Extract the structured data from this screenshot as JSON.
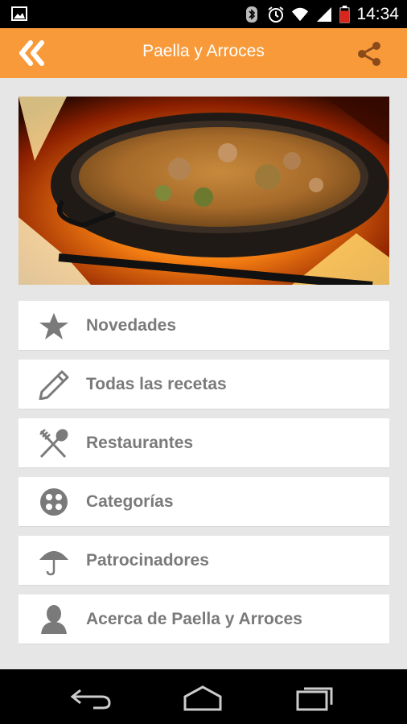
{
  "status_bar": {
    "time": "14:34",
    "icons": [
      "image-icon",
      "bluetooth-icon",
      "alarm-icon",
      "wifi-icon",
      "signal-icon",
      "battery-icon"
    ]
  },
  "action_bar": {
    "title": "Paella y Arroces",
    "back_icon": "double-chevron-left-icon",
    "share_icon": "share-icon",
    "color": "#f89a3a"
  },
  "hero": {
    "description_icon": "paella-pan-fire-image"
  },
  "menu": {
    "items": [
      {
        "label": "Novedades",
        "icon": "star-icon"
      },
      {
        "label": "Todas las recetas",
        "icon": "pencil-icon"
      },
      {
        "label": "Restaurantes",
        "icon": "fork-spoon-icon"
      },
      {
        "label": "Categorías",
        "icon": "categories-icon"
      },
      {
        "label": "Patrocinadores",
        "icon": "umbrella-icon"
      },
      {
        "label": "Acerca de Paella y Arroces",
        "icon": "person-icon"
      }
    ]
  },
  "nav_bar": {
    "buttons": [
      "back-nav-icon",
      "home-nav-icon",
      "recents-nav-icon"
    ]
  }
}
